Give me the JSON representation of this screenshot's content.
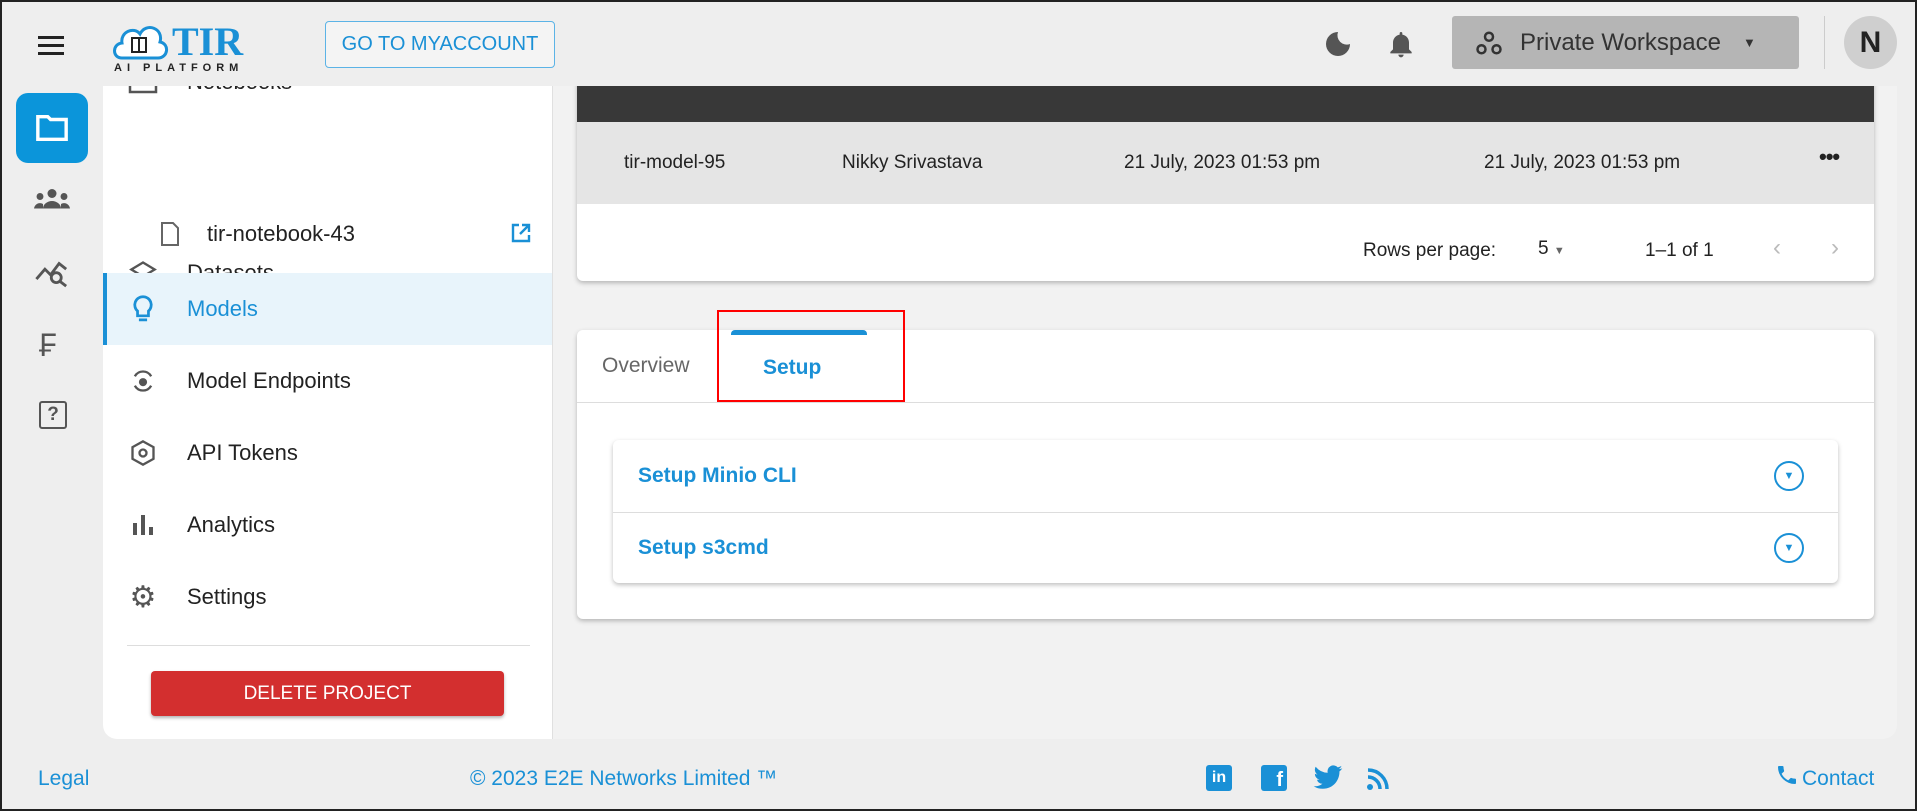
{
  "header": {
    "logo_text": "TIR",
    "logo_sub": "AI PLATFORM",
    "myaccount": "GO TO MYACCOUNT",
    "workspace": "Private Workspace",
    "avatar": "N"
  },
  "sidebar": {
    "items": [
      {
        "label": "Notebooks",
        "icon": "notebook-icon"
      },
      {
        "label": "tir-notebook-43",
        "icon": "file-icon"
      },
      {
        "label": "Datasets",
        "icon": "layers-icon"
      },
      {
        "label": "Models",
        "icon": "lightbulb-icon",
        "active": true
      },
      {
        "label": "Model Endpoints",
        "icon": "endpoint-icon"
      },
      {
        "label": "API Tokens",
        "icon": "token-icon"
      },
      {
        "label": "Analytics",
        "icon": "bar-chart-icon"
      },
      {
        "label": "Settings",
        "icon": "gear-icon"
      }
    ],
    "delete": "DELETE PROJECT"
  },
  "table": {
    "rows": [
      {
        "name": "tir-model-95",
        "owner": "Nikky Srivastava",
        "created": "21 July, 2023 01:53 pm",
        "updated": "21 July, 2023 01:53 pm"
      }
    ],
    "rows_per_page_label": "Rows per page:",
    "rows_per_page": "5",
    "range": "1–1 of 1"
  },
  "tabs": [
    {
      "label": "Overview"
    },
    {
      "label": "Setup",
      "active": true
    }
  ],
  "accordion": [
    {
      "label": "Setup Minio CLI"
    },
    {
      "label": "Setup s3cmd"
    }
  ],
  "footer": {
    "legal": "Legal",
    "copyright": "© 2023 E2E Networks Limited ™",
    "contact": "Contact"
  },
  "colors": {
    "accent": "#1a90d6",
    "danger": "#d32f2f",
    "highlight": "#ff0000"
  }
}
